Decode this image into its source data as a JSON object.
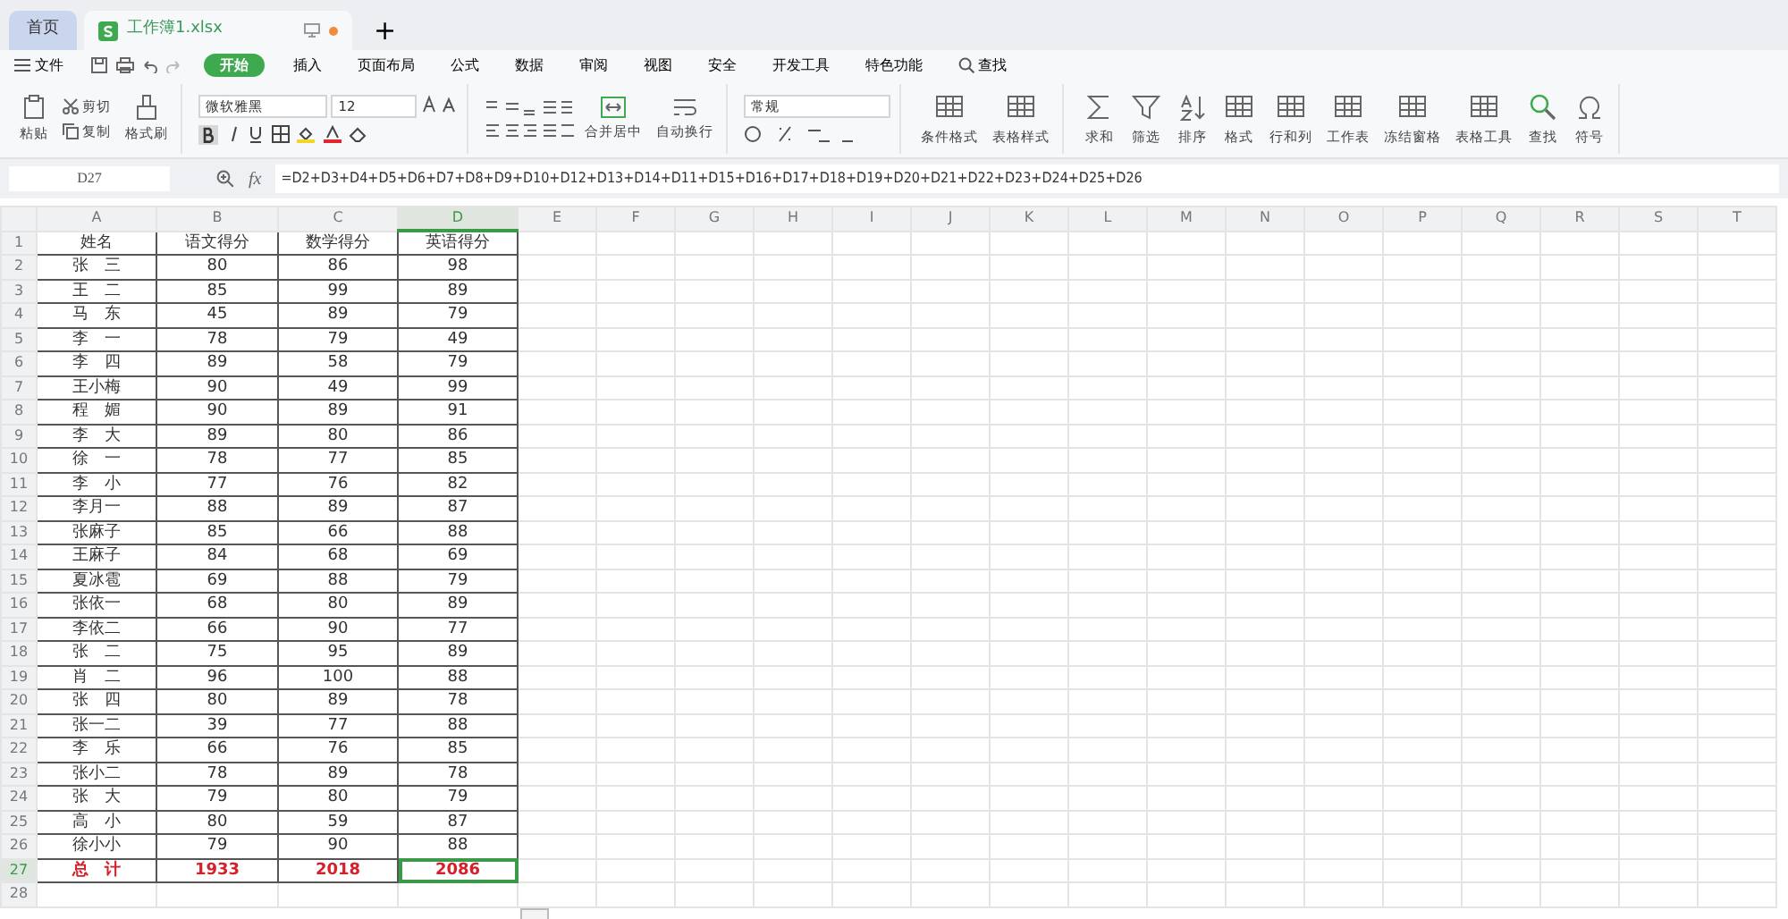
{
  "tabs": [
    {
      "label": "首页",
      "kind": "home",
      "selected": false
    },
    {
      "label": "工作簿1.xlsx",
      "kind": "file",
      "selected": true,
      "modified": true
    }
  ],
  "new_tab": "+",
  "menu": {
    "file": "文件",
    "tabs": [
      {
        "label": "开始",
        "selected": true
      },
      {
        "label": "插入",
        "selected": false
      },
      {
        "label": "页面布局",
        "selected": false
      },
      {
        "label": "公式",
        "selected": false
      },
      {
        "label": "数据",
        "selected": false
      },
      {
        "label": "审阅",
        "selected": false
      },
      {
        "label": "视图",
        "selected": false
      },
      {
        "label": "安全",
        "selected": false
      },
      {
        "label": "开发工具",
        "selected": false
      },
      {
        "label": "特色功能",
        "selected": false
      }
    ],
    "search": "查找"
  },
  "ribbon": {
    "paste": "粘贴",
    "cut": "剪切",
    "copy": "复制",
    "format_painter": "格式刷",
    "font": "微软雅黑",
    "font_size": "12",
    "merge": "合并居中",
    "wrap": "自动换行",
    "number_format": "常规",
    "tools": [
      {
        "label": "条件格式",
        "kind": "grid"
      },
      {
        "label": "表格样式",
        "kind": "grid"
      },
      {
        "label": "求和",
        "kind": "sum"
      },
      {
        "label": "筛选",
        "kind": "filter"
      },
      {
        "label": "排序",
        "kind": "sort"
      },
      {
        "label": "格式",
        "kind": "grid"
      },
      {
        "label": "行和列",
        "kind": "grid"
      },
      {
        "label": "工作表",
        "kind": "grid"
      },
      {
        "label": "冻结窗格",
        "kind": "grid"
      },
      {
        "label": "表格工具",
        "kind": "grid"
      },
      {
        "label": "查找",
        "kind": "search"
      },
      {
        "label": "符号",
        "kind": "omega"
      }
    ]
  },
  "formula_bar": {
    "name_box": "D27",
    "fx": "fx",
    "formula": "=D2+D3+D4+D5+D6+D7+D8+D9+D10+D12+D13+D14+D11+D15+D16+D17+D18+D19+D20+D21+D22+D23+D24+D25+D26"
  },
  "columns": [
    {
      "label": "A",
      "selected": false
    },
    {
      "label": "B",
      "selected": false
    },
    {
      "label": "C",
      "selected": false
    },
    {
      "label": "D",
      "selected": true
    },
    {
      "label": "E",
      "selected": false
    },
    {
      "label": "F",
      "selected": false
    },
    {
      "label": "G",
      "selected": false
    },
    {
      "label": "H",
      "selected": false
    },
    {
      "label": "I",
      "selected": false
    },
    {
      "label": "J",
      "selected": false
    },
    {
      "label": "K",
      "selected": false
    },
    {
      "label": "L",
      "selected": false
    },
    {
      "label": "M",
      "selected": false
    },
    {
      "label": "N",
      "selected": false
    },
    {
      "label": "O",
      "selected": false
    },
    {
      "label": "P",
      "selected": false
    },
    {
      "label": "Q",
      "selected": false
    },
    {
      "label": "R",
      "selected": false
    },
    {
      "label": "S",
      "selected": false
    },
    {
      "label": "T",
      "selected": false
    }
  ],
  "rows": [
    {
      "number": "1",
      "kind": "data",
      "selected": false,
      "cells": [
        "姓名",
        "语文得分",
        "数学得分",
        "英语得分"
      ]
    },
    {
      "number": "2",
      "kind": "data",
      "selected": false,
      "cells": [
        "张　三",
        "80",
        "86",
        "98"
      ]
    },
    {
      "number": "3",
      "kind": "data",
      "selected": false,
      "cells": [
        "王　二",
        "85",
        "99",
        "89"
      ]
    },
    {
      "number": "4",
      "kind": "data",
      "selected": false,
      "cells": [
        "马　东",
        "45",
        "89",
        "79"
      ]
    },
    {
      "number": "5",
      "kind": "data",
      "selected": false,
      "cells": [
        "李　一",
        "78",
        "79",
        "49"
      ]
    },
    {
      "number": "6",
      "kind": "data",
      "selected": false,
      "cells": [
        "李　四",
        "89",
        "58",
        "79"
      ]
    },
    {
      "number": "7",
      "kind": "data",
      "selected": false,
      "cells": [
        "王小梅",
        "90",
        "49",
        "99"
      ]
    },
    {
      "number": "8",
      "kind": "data",
      "selected": false,
      "cells": [
        "程　媚",
        "90",
        "89",
        "91"
      ]
    },
    {
      "number": "9",
      "kind": "data",
      "selected": false,
      "cells": [
        "李　大",
        "89",
        "80",
        "86"
      ]
    },
    {
      "number": "10",
      "kind": "data",
      "selected": false,
      "cells": [
        "徐　一",
        "78",
        "77",
        "85"
      ]
    },
    {
      "number": "11",
      "kind": "data",
      "selected": false,
      "cells": [
        "李　小",
        "77",
        "76",
        "82"
      ]
    },
    {
      "number": "12",
      "kind": "data",
      "selected": false,
      "cells": [
        "李月一",
        "88",
        "89",
        "87"
      ]
    },
    {
      "number": "13",
      "kind": "data",
      "selected": false,
      "cells": [
        "张麻子",
        "85",
        "66",
        "88"
      ]
    },
    {
      "number": "14",
      "kind": "data",
      "selected": false,
      "cells": [
        "王麻子",
        "84",
        "68",
        "69"
      ]
    },
    {
      "number": "15",
      "kind": "data",
      "selected": false,
      "cells": [
        "夏冰雹",
        "69",
        "88",
        "79"
      ]
    },
    {
      "number": "16",
      "kind": "data",
      "selected": false,
      "cells": [
        "张依一",
        "68",
        "80",
        "89"
      ]
    },
    {
      "number": "17",
      "kind": "data",
      "selected": false,
      "cells": [
        "李依二",
        "66",
        "90",
        "77"
      ]
    },
    {
      "number": "18",
      "kind": "data",
      "selected": false,
      "cells": [
        "张　二",
        "75",
        "95",
        "89"
      ]
    },
    {
      "number": "19",
      "kind": "data",
      "selected": false,
      "cells": [
        "肖　二",
        "96",
        "100",
        "88"
      ]
    },
    {
      "number": "20",
      "kind": "data",
      "selected": false,
      "cells": [
        "张　四",
        "80",
        "89",
        "78"
      ]
    },
    {
      "number": "21",
      "kind": "data",
      "selected": false,
      "cells": [
        "张一二",
        "39",
        "77",
        "88"
      ]
    },
    {
      "number": "22",
      "kind": "data",
      "selected": false,
      "cells": [
        "李　乐",
        "66",
        "76",
        "85"
      ]
    },
    {
      "number": "23",
      "kind": "data",
      "selected": false,
      "cells": [
        "张小二",
        "78",
        "89",
        "78"
      ]
    },
    {
      "number": "24",
      "kind": "data",
      "selected": false,
      "cells": [
        "张　大",
        "79",
        "80",
        "79"
      ]
    },
    {
      "number": "25",
      "kind": "data",
      "selected": false,
      "cells": [
        "高　小",
        "80",
        "59",
        "87"
      ]
    },
    {
      "number": "26",
      "kind": "data",
      "selected": false,
      "cells": [
        "徐小小",
        "79",
        "90",
        "88"
      ]
    },
    {
      "number": "27",
      "kind": "total",
      "selected": true,
      "cells": [
        "总　计",
        "1933",
        "2018",
        "2086"
      ]
    },
    {
      "number": "28",
      "kind": "empty",
      "selected": false,
      "cells": []
    }
  ]
}
